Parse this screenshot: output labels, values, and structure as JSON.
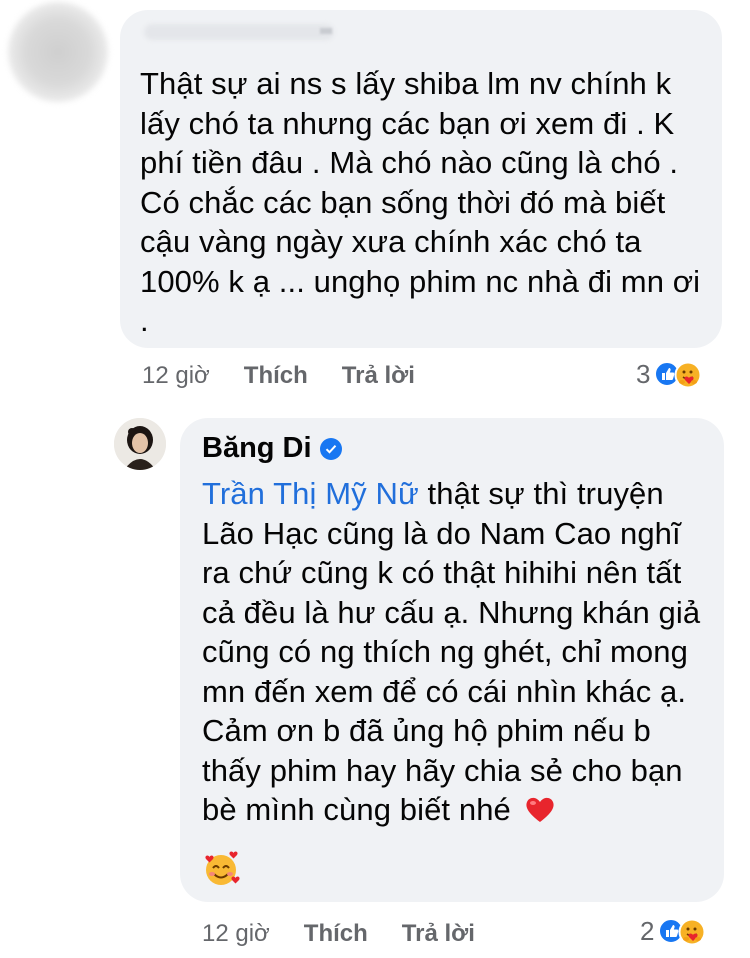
{
  "comment1": {
    "text": "Thật sự ai ns s lấy shiba lm nv chính k lấy chó ta nhưng các bạn ơi xem đi . K phí tiền đâu . Mà chó nào cũng là chó . Có chắc các bạn sống thời đó mà biết cậu vàng ngày xưa chính xác chó ta 100% k ạ ... unghọ phim nc nhà đi mn ơi .",
    "time": "12 giờ",
    "like_label": "Thích",
    "reply_label": "Trả lời",
    "reaction_count": "3",
    "reaction_icons": [
      "like-icon",
      "care-icon"
    ]
  },
  "comment2": {
    "author": "Băng Di",
    "verified_icon": "verified-badge-icon",
    "mention": "Trần Thị Mỹ Nữ",
    "text": " thật sự thì truyện Lão Hạc cũng là do Nam Cao nghĩ ra chứ cũng k có thật hihihi nên tất cả đều là hư cấu ạ. Nhưng khán giả cũng có ng thích ng ghét, chỉ mong mn đến xem để có cái nhìn khác ạ. Cảm ơn b đã ủng hộ phim nếu b thấy phim hay hãy chia sẻ cho bạn bè mình cùng biết nhé",
    "inline_emoji": "red-heart-icon",
    "trailing_emoji": "smiling-face-with-hearts-icon",
    "time": "12 giờ",
    "like_label": "Thích",
    "reply_label": "Trả lời",
    "reaction_count": "2",
    "reaction_icons": [
      "like-icon",
      "care-icon"
    ]
  },
  "colors": {
    "bubble": "#f0f2f5",
    "mention": "#216fdb",
    "meta": "#65676b",
    "like_blue": "#1877f2",
    "heart_red": "#e8252d"
  }
}
